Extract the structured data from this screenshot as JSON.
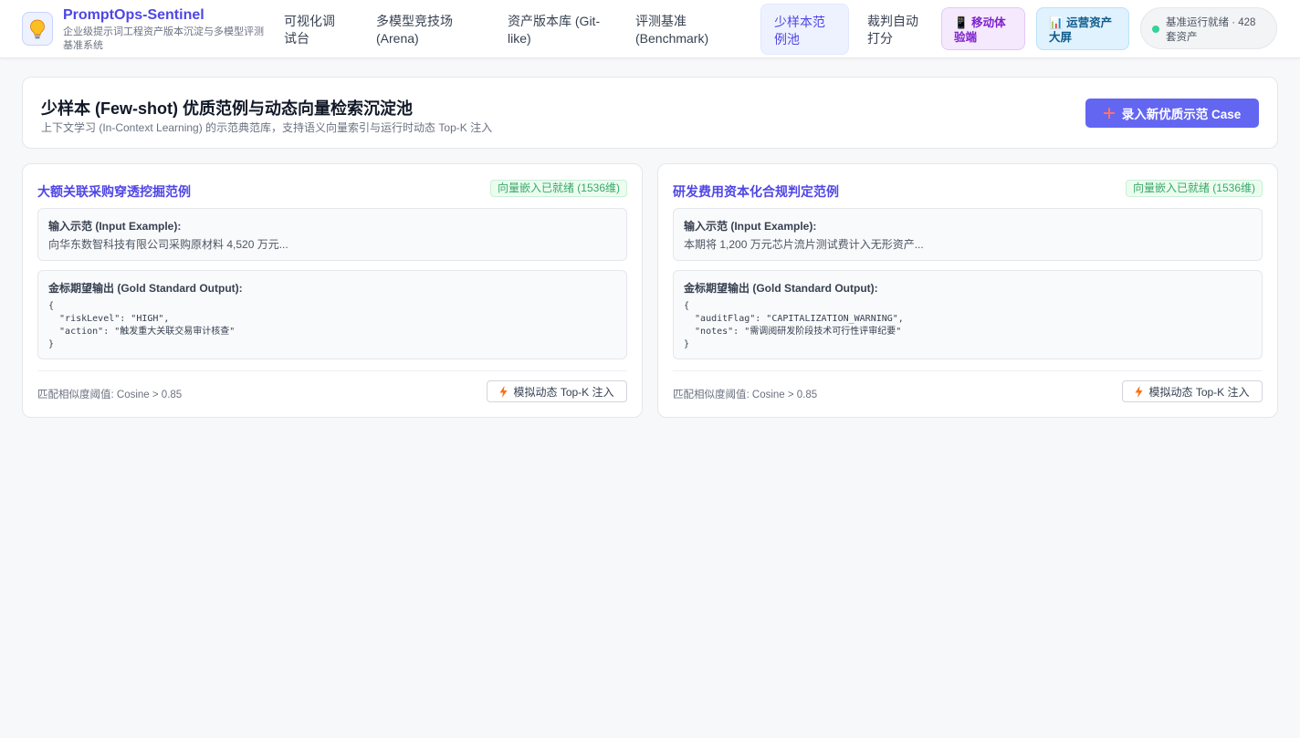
{
  "brand": {
    "title": "PromptOps-Sentinel",
    "subtitle": "企业级提示词工程资产版本沉淀与多模型评测基准系统",
    "logo_icon": "lightbulb-icon"
  },
  "nav": {
    "items": [
      {
        "label": "可视化调试台"
      },
      {
        "label": "多模型竞技场 (Arena)"
      },
      {
        "label": "资产版本库 (Git-like)"
      },
      {
        "label": "评测基准 (Benchmark)"
      },
      {
        "label": "少样本范例池",
        "active": true
      },
      {
        "label": "裁判自动打分"
      }
    ],
    "mobile": {
      "icon": "phone-icon",
      "label": "移动体验端"
    },
    "screen": {
      "icon": "bar-chart-icon",
      "label": "运营资产大屏"
    },
    "status": "基准运行就绪 · 428 套资产"
  },
  "page": {
    "title": "少样本 (Few-shot) 优质范例与动态向量检索沉淀池",
    "subtitle": "上下文学习 (In-Context Learning) 的示范典范库，支持语义向量索引与运行时动态 Top-K 注入",
    "add_button": "录入新优质示范 Case"
  },
  "cases": [
    {
      "title": "大额关联采购穿透挖掘范例",
      "badge": "向量嵌入已就绪 (1536维)",
      "input_label": "输入示范 (Input Example):",
      "input_text": "向华东数智科技有限公司采购原材料 4,520 万元...",
      "gold_label": "金标期望输出 (Gold Standard Output):",
      "gold_code": "{\n  \"riskLevel\": \"HIGH\",\n  \"action\": \"触发重大关联交易审计核查\"\n}",
      "threshold": "匹配相似度阈值: Cosine > 0.85",
      "sim_button": "模拟动态 Top-K 注入"
    },
    {
      "title": "研发费用资本化合规判定范例",
      "badge": "向量嵌入已就绪 (1536维)",
      "input_label": "输入示范 (Input Example):",
      "input_text": "本期将 1,200 万元芯片流片测试费计入无形资产...",
      "gold_label": "金标期望输出 (Gold Standard Output):",
      "gold_code": "{\n  \"auditFlag\": \"CAPITALIZATION_WARNING\",\n  \"notes\": \"需调阅研发阶段技术可行性评审纪要\"\n}",
      "threshold": "匹配相似度阈值: Cosine > 0.85",
      "sim_button": "模拟动态 Top-K 注入"
    }
  ],
  "colors": {
    "accent": "#4f46e5",
    "primary_button": "#6366f1",
    "status_dot": "#34d399",
    "badge_green": "#3aa768"
  }
}
